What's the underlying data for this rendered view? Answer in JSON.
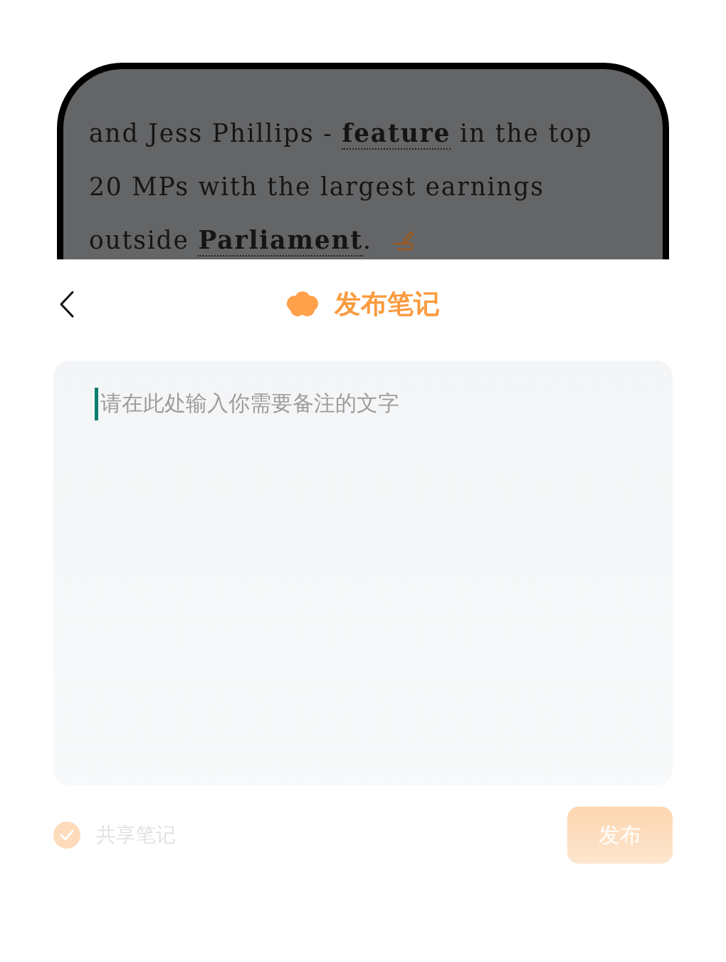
{
  "article": {
    "lines": [
      "and Jess Phillips - **feature** in the top",
      "20 MPs with the largest earnings",
      "outside **Parliament**."
    ]
  },
  "header": {
    "title": "发布笔记"
  },
  "note_field": {
    "placeholder": "请在此处输入你需要备注的文字",
    "focused": true
  },
  "share": {
    "label": "共享笔记",
    "checked": true,
    "disabled": true
  },
  "publish_button": {
    "label": "发布",
    "disabled": true
  }
}
